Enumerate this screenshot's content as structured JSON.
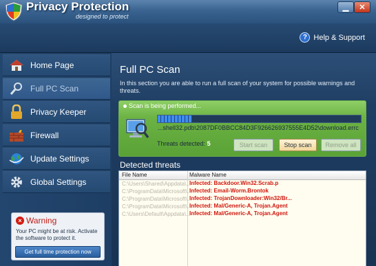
{
  "window": {
    "title": "Privacy Protection",
    "subtitle": "designed to protect",
    "minimize": "▁",
    "close": "✕"
  },
  "header": {
    "help_label": "Help & Support",
    "help_icon_glyph": "?"
  },
  "sidebar": {
    "items": [
      {
        "label": "Home Page",
        "icon": "house-icon"
      },
      {
        "label": "Full PC Scan",
        "icon": "magnifier-icon",
        "active": true
      },
      {
        "label": "Privacy Keeper",
        "icon": "padlock-icon"
      },
      {
        "label": "Firewall",
        "icon": "firewall-icon"
      },
      {
        "label": "Update Settings",
        "icon": "globe-icon"
      },
      {
        "label": "Global Settings",
        "icon": "gear-icon"
      }
    ],
    "warning": {
      "title": "Warning",
      "text": "Your PC might be at risk. Activate the software to protect it.",
      "button": "Get full time protection now"
    }
  },
  "main": {
    "title": "Full PC Scan",
    "description": "In this section you are able to run a full scan of your system for possible warnings and threats.",
    "scan": {
      "status": "Scan is being performed...",
      "progress": 0.17,
      "current_file": "...shell32.pdb\\2087DF0BBCC84D3F926626937555E4D52\\download.errc",
      "threats_label": "Threats detected:",
      "threats_count": "5",
      "start_button": "Start scan",
      "stop_button": "Stop scan",
      "remove_button": "Remove all"
    },
    "detected": {
      "title": "Detected threats",
      "columns": [
        "File Name",
        "Malware Name"
      ],
      "rows": [
        {
          "path": "C:\\Users\\Shared\\Appdata\\...",
          "malware": "Infected: Backdoor.Win32.Scrab.p"
        },
        {
          "path": "C:\\ProgramData\\Microsoft\\...",
          "malware": "Infected: Email-Worm.Brontok"
        },
        {
          "path": "C:\\ProgramData\\Microsoft\\...",
          "malware": "Infected: TrojanDownloader:Win32/Br..."
        },
        {
          "path": "C:\\ProgramData\\Microsoft\\...",
          "malware": "Infected: Mal/Generic-A, Trojan.Agent"
        },
        {
          "path": "C:\\Users\\Default\\Appdata\\...",
          "malware": "Infected: Mal/Generic-A, Trojan.Agent"
        }
      ]
    }
  },
  "colors": {
    "accent": "#2d6fd0",
    "danger": "#d0160d",
    "scan_green": "#6cb244"
  }
}
